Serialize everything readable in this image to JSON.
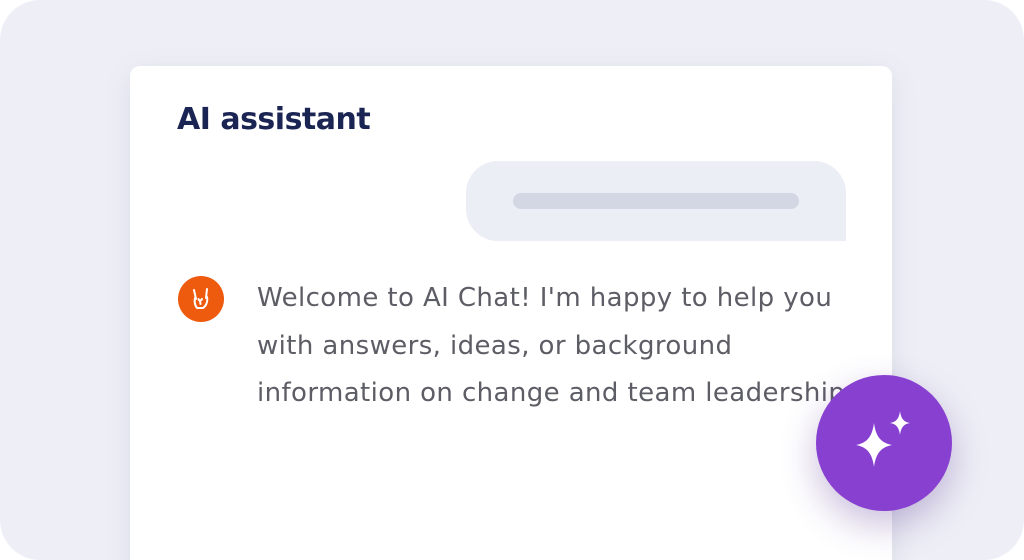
{
  "colors": {
    "background": "#eeeff6",
    "card": "#ffffff",
    "title": "#1b2553",
    "user_bubble": "#eceef5",
    "placeholder": "#d3d7e4",
    "avatar": "#ee5a0e",
    "message_text": "#5d5d66",
    "fab": "#8840d1"
  },
  "chat": {
    "title": "AI assistant",
    "messages": [
      {
        "role": "user",
        "content": "placeholder-line"
      },
      {
        "role": "assistant",
        "avatar_icon": "rock-hand-icon",
        "text": "Welcome to AI Chat! I'm happy to help you with answers, ideas, or background information on change and team leadership."
      }
    ]
  },
  "fab": {
    "icon": "sparkle-icon"
  }
}
